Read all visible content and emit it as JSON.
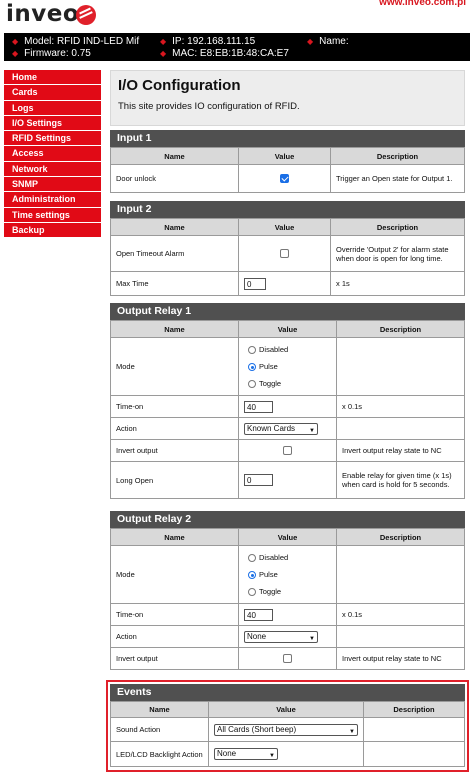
{
  "header": {
    "logo_text": "inveo",
    "site_link": "www.inveo.com.pl"
  },
  "infobar": {
    "model": "Model: RFID IND-LED Mif",
    "firmware": "Firmware: 0.75",
    "ip": "IP: 192.168.111.15",
    "mac": "MAC: E8:EB:1B:48:CA:E7",
    "name": "Name:"
  },
  "sidebar": {
    "items": [
      {
        "label": "Home"
      },
      {
        "label": "Cards"
      },
      {
        "label": "Logs"
      },
      {
        "label": "I/O Settings"
      },
      {
        "label": "RFID Settings"
      },
      {
        "label": "Access"
      },
      {
        "label": "Network"
      },
      {
        "label": "SNMP"
      },
      {
        "label": "Administration"
      },
      {
        "label": "Time settings"
      },
      {
        "label": "Backup"
      }
    ]
  },
  "page": {
    "title": "I/O Configuration",
    "description": "This site provides IO configuration of RFID."
  },
  "columns": {
    "name": "Name",
    "value": "Value",
    "description": "Description"
  },
  "input1": {
    "title": "Input 1",
    "rows": [
      {
        "name": "Door unlock",
        "checked": true,
        "description": "Trigger an Open state for Output 1."
      }
    ]
  },
  "input2": {
    "title": "Input 2",
    "rows": [
      {
        "name": "Open Timeout Alarm",
        "checked": false,
        "description": "Override 'Output 2' for alarm state when door is open for long time."
      },
      {
        "name": "Max Time",
        "value": "0",
        "description": "x 1s"
      }
    ]
  },
  "relay1": {
    "title": "Output Relay 1",
    "mode_label": "Mode",
    "mode_options": [
      "Disabled",
      "Pulse",
      "Toggle"
    ],
    "mode_selected": "Pulse",
    "timeon_label": "Time-on",
    "timeon_value": "40",
    "timeon_desc": "x 0.1s",
    "action_label": "Action",
    "action_value": "Known Cards",
    "invert_label": "Invert output",
    "invert_checked": false,
    "invert_desc": "Invert output relay state to NC",
    "longopen_label": "Long Open",
    "longopen_value": "0",
    "longopen_desc": "Enable relay for given time (x 1s) when card is hold for 5 seconds."
  },
  "relay2": {
    "title": "Output Relay 2",
    "mode_label": "Mode",
    "mode_options": [
      "Disabled",
      "Pulse",
      "Toggle"
    ],
    "mode_selected": "Pulse",
    "timeon_label": "Time-on",
    "timeon_value": "40",
    "timeon_desc": "x 0.1s",
    "action_label": "Action",
    "action_value": "None",
    "invert_label": "Invert output",
    "invert_checked": false,
    "invert_desc": "Invert output relay state to NC"
  },
  "events": {
    "title": "Events",
    "sound_label": "Sound Action",
    "sound_value": "All Cards (Short beep)",
    "backlight_label": "LED/LCD Backlight Action",
    "backlight_value": "None"
  },
  "colors": {
    "nav_red": "#e10a16",
    "section_header": "#505050",
    "accent_blue": "#1a6fe6",
    "highlight_red": "#e0202a"
  }
}
